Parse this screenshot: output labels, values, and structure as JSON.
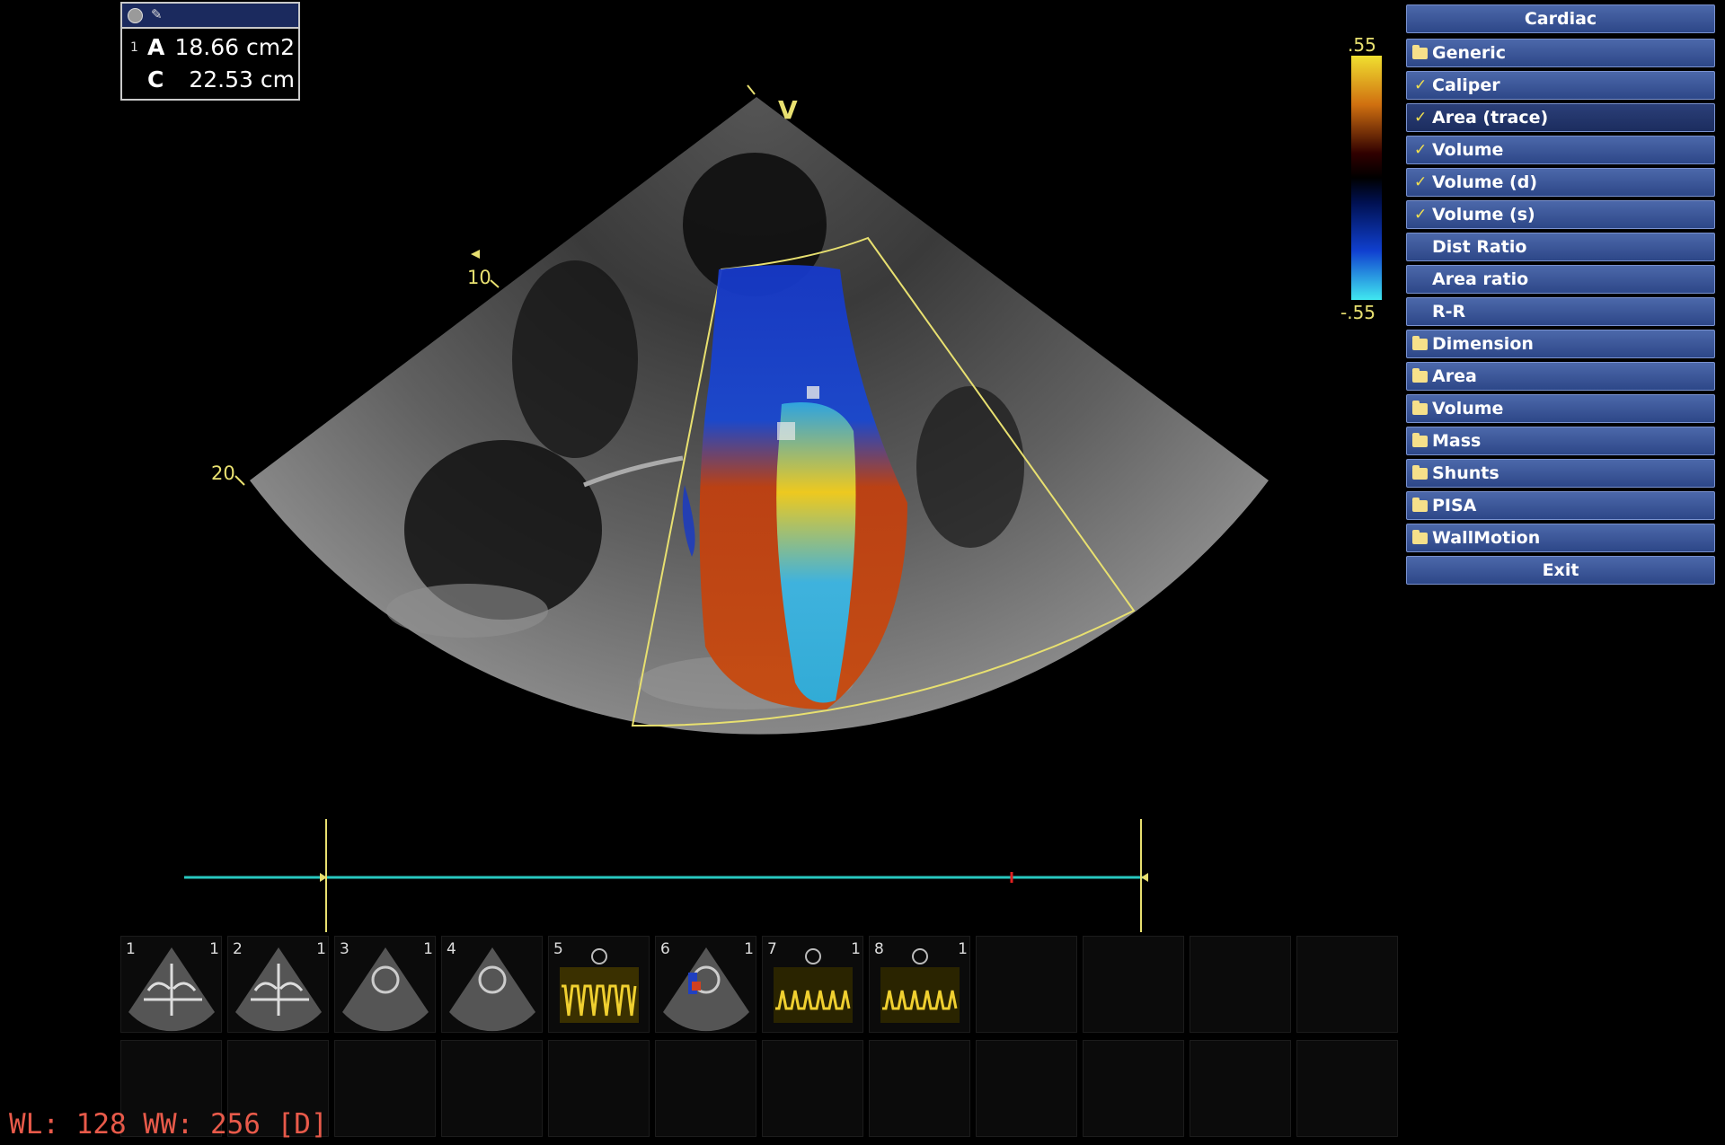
{
  "measurement": {
    "rows": [
      {
        "index": "1",
        "label": "A",
        "value": "18.66 cm2"
      },
      {
        "index": "",
        "label": "C",
        "value": "22.53 cm"
      }
    ]
  },
  "depth_markers": [
    "10",
    "20"
  ],
  "sector_marker": "V",
  "color_scale": {
    "top": ".55",
    "bottom": "-.55"
  },
  "menu": {
    "title": "Cardiac",
    "items": [
      {
        "label": "Generic",
        "icon": "folder-icon",
        "checked": false,
        "selected": false
      },
      {
        "label": "Caliper",
        "icon": "check-icon",
        "checked": true,
        "selected": false
      },
      {
        "label": "Area (trace)",
        "icon": "check-icon",
        "checked": true,
        "selected": true
      },
      {
        "label": "Volume",
        "icon": "check-icon",
        "checked": true,
        "selected": false
      },
      {
        "label": "Volume (d)",
        "icon": "check-icon",
        "checked": true,
        "selected": false
      },
      {
        "label": "Volume (s)",
        "icon": "check-icon",
        "checked": true,
        "selected": false
      },
      {
        "label": "Dist Ratio",
        "icon": "",
        "checked": false,
        "selected": false
      },
      {
        "label": "Area ratio",
        "icon": "",
        "checked": false,
        "selected": false
      },
      {
        "label": "R-R",
        "icon": "",
        "checked": false,
        "selected": false
      },
      {
        "label": "Dimension",
        "icon": "folder-icon",
        "checked": false,
        "selected": false
      },
      {
        "label": "Area",
        "icon": "folder-icon",
        "checked": false,
        "selected": false
      },
      {
        "label": "Volume",
        "icon": "folder-icon",
        "checked": false,
        "selected": false
      },
      {
        "label": "Mass",
        "icon": "folder-icon",
        "checked": false,
        "selected": false
      },
      {
        "label": "Shunts",
        "icon": "folder-icon",
        "checked": false,
        "selected": false
      },
      {
        "label": "PISA",
        "icon": "folder-icon",
        "checked": false,
        "selected": false
      },
      {
        "label": "WallMotion",
        "icon": "folder-icon",
        "checked": false,
        "selected": false
      }
    ],
    "exit_label": "Exit"
  },
  "thumbnails": [
    {
      "num": "1",
      "num2": "1",
      "kind": "4ch"
    },
    {
      "num": "2",
      "num2": "1",
      "kind": "4ch"
    },
    {
      "num": "3",
      "num2": "1",
      "kind": "sax"
    },
    {
      "num": "4",
      "num2": "",
      "kind": "sax"
    },
    {
      "num": "5",
      "num2": "",
      "kind": "doppler"
    },
    {
      "num": "6",
      "num2": "1",
      "kind": "color"
    },
    {
      "num": "7",
      "num2": "1",
      "kind": "doppler2"
    },
    {
      "num": "8",
      "num2": "1",
      "kind": "doppler2"
    }
  ],
  "window_level": "WL: 128 WW: 256 [D]",
  "colors": {
    "menu_bg": "#3b5597",
    "overlay_yellow": "#e8e070",
    "timeline": "#28c8c0",
    "wl_text": "#e85a4a"
  }
}
